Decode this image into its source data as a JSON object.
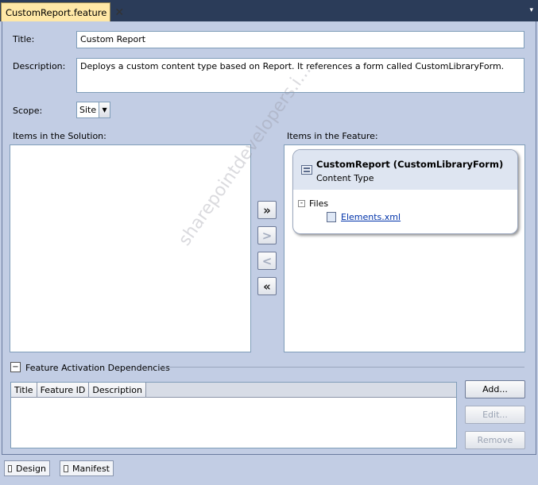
{
  "document_tab": {
    "title": "CustomReport.feature",
    "close_glyph": "✕"
  },
  "tab_menu_glyph": "▾",
  "form": {
    "title_label": "Title:",
    "title_value": "Custom Report",
    "description_label": "Description:",
    "description_value": "Deploys a custom content type based on Report. It references a form called CustomLibraryForm.",
    "scope_label": "Scope:",
    "scope_value": "Site"
  },
  "solution_items": {
    "label": "Items in the Solution:"
  },
  "feature_items": {
    "label": "Items in the Feature:",
    "card": {
      "title": "CustomReport (CustomLibraryForm)",
      "subtitle": "Content Type",
      "files_label": "Files",
      "file": "Elements.xml",
      "icon": "content-type-icon"
    }
  },
  "move_buttons": {
    "add_all": "»",
    "add": ">",
    "remove": "<",
    "remove_all": "«"
  },
  "dependencies": {
    "header": "Feature Activation Dependencies",
    "columns": [
      "Title",
      "Feature ID",
      "Description"
    ],
    "add_button": "Add...",
    "edit_button": "Edit...",
    "remove_button": "Remove"
  },
  "bottom_tabs": [
    "Design",
    "Manifest"
  ],
  "watermark": "sharepointdevelopers.i..."
}
